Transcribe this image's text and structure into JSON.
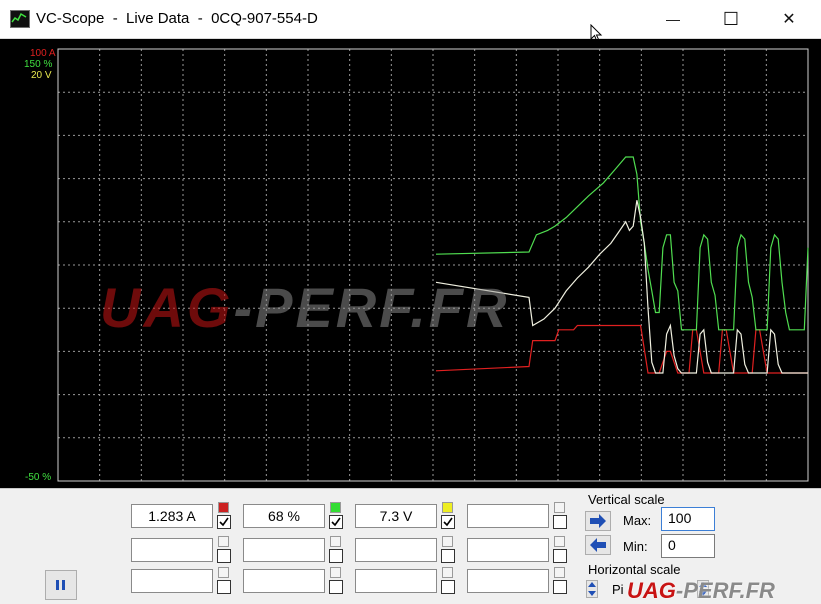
{
  "window": {
    "title": "VC-Scope  -  Live Data  -  0CQ-907-554-D",
    "minimize_glyph": "—",
    "maximize_glyph": "☐",
    "close_glyph": "✕"
  },
  "scope": {
    "scale_labels": [
      {
        "text": "100 A",
        "color": "#e02020"
      },
      {
        "text": "150 %",
        "color": "#40e040"
      },
      {
        "text": "20 V",
        "color": "#e8e850"
      }
    ],
    "bottom_label": {
      "text": "-50 %",
      "color": "#40e040"
    },
    "background": "#000000",
    "grid_color": "#9a9a9a"
  },
  "chart_data": {
    "type": "line",
    "ylim": [
      -50,
      150
    ],
    "series": [
      {
        "color": "#e02020",
        "points": [
          [
            0,
            1
          ],
          [
            25,
            3
          ],
          [
            26,
            15
          ],
          [
            32,
            15
          ],
          [
            33,
            20
          ],
          [
            37,
            20
          ],
          [
            38,
            22
          ],
          [
            55,
            22
          ],
          [
            57,
            0
          ],
          [
            60,
            0
          ],
          [
            62,
            10
          ],
          [
            63,
            10
          ],
          [
            65,
            0
          ],
          [
            68,
            0
          ],
          [
            69,
            20
          ],
          [
            70,
            20
          ],
          [
            72,
            0
          ],
          [
            76,
            0
          ],
          [
            77,
            20
          ],
          [
            78,
            20
          ],
          [
            80,
            0
          ],
          [
            85,
            0
          ],
          [
            86,
            20
          ],
          [
            87,
            20
          ],
          [
            89,
            0
          ],
          [
            100,
            0
          ]
        ]
      },
      {
        "color": "#50dd50",
        "points": [
          [
            0,
            55
          ],
          [
            25,
            56
          ],
          [
            27,
            64
          ],
          [
            30,
            66
          ],
          [
            32,
            68
          ],
          [
            35,
            72
          ],
          [
            38,
            77
          ],
          [
            41,
            82
          ],
          [
            45,
            88
          ],
          [
            48,
            94
          ],
          [
            51,
            100
          ],
          [
            53,
            100
          ],
          [
            54,
            92
          ],
          [
            55,
            70
          ],
          [
            56,
            60
          ],
          [
            57,
            48
          ],
          [
            58,
            38
          ],
          [
            59,
            28
          ],
          [
            60,
            28
          ],
          [
            61,
            58
          ],
          [
            62,
            64
          ],
          [
            63,
            64
          ],
          [
            64,
            42
          ],
          [
            65,
            38
          ],
          [
            66,
            20
          ],
          [
            70,
            20
          ],
          [
            71,
            58
          ],
          [
            72,
            64
          ],
          [
            73,
            62
          ],
          [
            74,
            42
          ],
          [
            75,
            36
          ],
          [
            76,
            20
          ],
          [
            80,
            20
          ],
          [
            81,
            58
          ],
          [
            82,
            64
          ],
          [
            83,
            62
          ],
          [
            84,
            42
          ],
          [
            85,
            35
          ],
          [
            86,
            20
          ],
          [
            89,
            20
          ],
          [
            90,
            58
          ],
          [
            91,
            64
          ],
          [
            92,
            62
          ],
          [
            93,
            42
          ],
          [
            94,
            28
          ],
          [
            95,
            20
          ],
          [
            99,
            20
          ],
          [
            100,
            58
          ]
        ]
      },
      {
        "color": "#f0f0e0",
        "points": [
          [
            0,
            42
          ],
          [
            25,
            35
          ],
          [
            26,
            22
          ],
          [
            29,
            25
          ],
          [
            32,
            30
          ],
          [
            35,
            38
          ],
          [
            38,
            44
          ],
          [
            41,
            49
          ],
          [
            44,
            55
          ],
          [
            47,
            60
          ],
          [
            49,
            65
          ],
          [
            51,
            70
          ],
          [
            52,
            66
          ],
          [
            53,
            68
          ],
          [
            54,
            80
          ],
          [
            55,
            72
          ],
          [
            56,
            60
          ],
          [
            57,
            30
          ],
          [
            58,
            5
          ],
          [
            59,
            0
          ],
          [
            60,
            0
          ],
          [
            61,
            0
          ],
          [
            62,
            18
          ],
          [
            63,
            22
          ],
          [
            64,
            8
          ],
          [
            65,
            2
          ],
          [
            66,
            0
          ],
          [
            70,
            0
          ],
          [
            71,
            18
          ],
          [
            72,
            20
          ],
          [
            73,
            5
          ],
          [
            74,
            0
          ],
          [
            80,
            0
          ],
          [
            81,
            20
          ],
          [
            82,
            18
          ],
          [
            83,
            4
          ],
          [
            84,
            0
          ],
          [
            89,
            0
          ],
          [
            90,
            20
          ],
          [
            91,
            18
          ],
          [
            92,
            4
          ],
          [
            93,
            0
          ],
          [
            100,
            0
          ]
        ]
      }
    ]
  },
  "watermark": {
    "text_red": "UAG",
    "text_gray": "-PERF.FR"
  },
  "channels": [
    {
      "value": "1.283 A",
      "swatch": "#cc2222",
      "checked": true
    },
    {
      "value": "68 %",
      "swatch": "#33dd33",
      "checked": true
    },
    {
      "value": "7.3 V",
      "swatch": "#eeee22",
      "checked": true
    },
    {
      "value": "",
      "swatch": "#f4f4f4",
      "checked": false
    },
    {
      "value": "",
      "swatch": "#f4f4f4",
      "checked": false
    },
    {
      "value": "",
      "swatch": "#f4f4f4",
      "checked": false
    },
    {
      "value": "",
      "swatch": "#f4f4f4",
      "checked": false
    },
    {
      "value": "",
      "swatch": "#f4f4f4",
      "checked": false
    },
    {
      "value": "",
      "swatch": "#f4f4f4",
      "checked": false
    },
    {
      "value": "",
      "swatch": "#f4f4f4",
      "checked": false
    },
    {
      "value": "",
      "swatch": "#f4f4f4",
      "checked": false
    },
    {
      "value": "",
      "swatch": "#f4f4f4",
      "checked": false
    }
  ],
  "vertical_scale": {
    "label": "Vertical scale",
    "max_label": "Max:",
    "max_value": "100",
    "min_label": "Min:",
    "min_value": "0"
  },
  "horizontal_scale": {
    "label": "Horizontal scale",
    "partial_label": "Pi"
  },
  "footer_watermark": {
    "text_red": "UAG",
    "text_gray": "-PERF.FR"
  }
}
